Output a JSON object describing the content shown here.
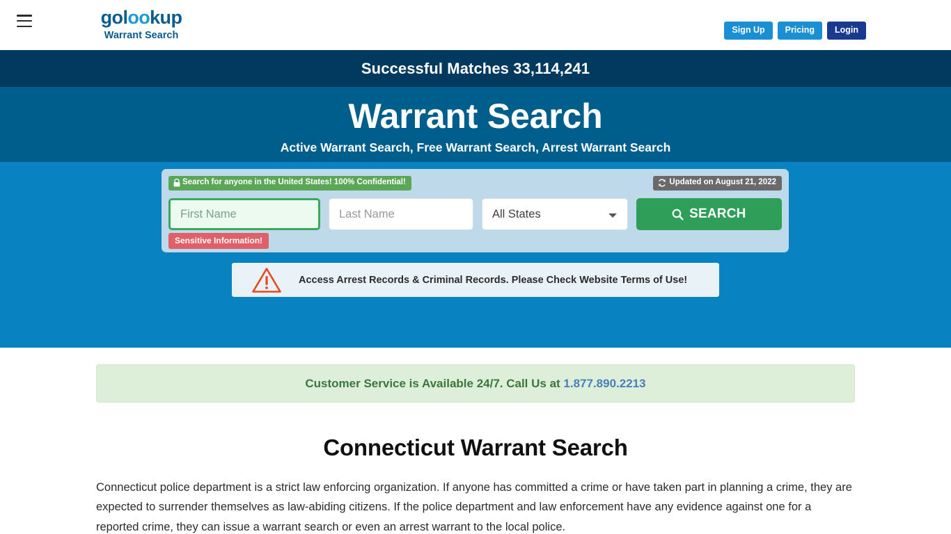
{
  "header": {
    "menu_icon": "hamburger-icon",
    "logo": {
      "text_pre": "gol",
      "text_lens": "oo",
      "text_post": "kup",
      "tagline": "Warrant Search"
    },
    "buttons": [
      {
        "label": "Sign Up",
        "style": "blue"
      },
      {
        "label": "Pricing",
        "style": "blue"
      },
      {
        "label": "Login",
        "style": "navy"
      }
    ]
  },
  "matches_bar": {
    "text": "Successful Matches 33,114,241"
  },
  "hero": {
    "title": "Warrant Search",
    "subtitle": "Active Warrant Search, Free Warrant Search, Arrest Warrant Search"
  },
  "search_panel": {
    "confidential_badge": {
      "icon": "lock-icon",
      "label": "Search for anyone in the United States! 100% Confidential!"
    },
    "updated_badge": {
      "icon": "refresh-icon",
      "label": "Updated on August 21, 2022"
    },
    "first_name": {
      "placeholder": "First Name",
      "value": ""
    },
    "last_name": {
      "placeholder": "Last Name",
      "value": ""
    },
    "state_select": {
      "selected": "All States",
      "options": [
        "All States"
      ]
    },
    "search_button": {
      "icon": "search-icon",
      "label": "SEARCH"
    },
    "sensitive_badge": {
      "label": "Sensitive Information!"
    }
  },
  "terms_notice": {
    "icon": "warning-triangle-icon",
    "text": "Access Arrest Records & Criminal Records. Please Check Website Terms of Use!"
  },
  "customer_service": {
    "text": "Customer Service is Available 24/7. Call Us at ",
    "phone": "1.877.890.2213"
  },
  "article": {
    "title": "Connecticut Warrant Search",
    "body": "Connecticut police department is a strict law enforcing organization. If anyone has committed a crime or have taken part in planning a crime, they are expected to surrender themselves as law-abiding citizens. If the police department and law enforcement have any evidence against one for a reported crime, they can issue a warrant search or even an arrest warrant to the local police."
  },
  "colors": {
    "navy_bar": "#02395e",
    "hero_band": "#005e8c",
    "search_band": "#0982c2",
    "panel": "#bed9e9",
    "green": "#2f9e58",
    "red": "#e06069",
    "gray_badge": "#6a6a6a",
    "cs_green_text": "#3c763d",
    "phone_link": "#4a7ebb"
  }
}
